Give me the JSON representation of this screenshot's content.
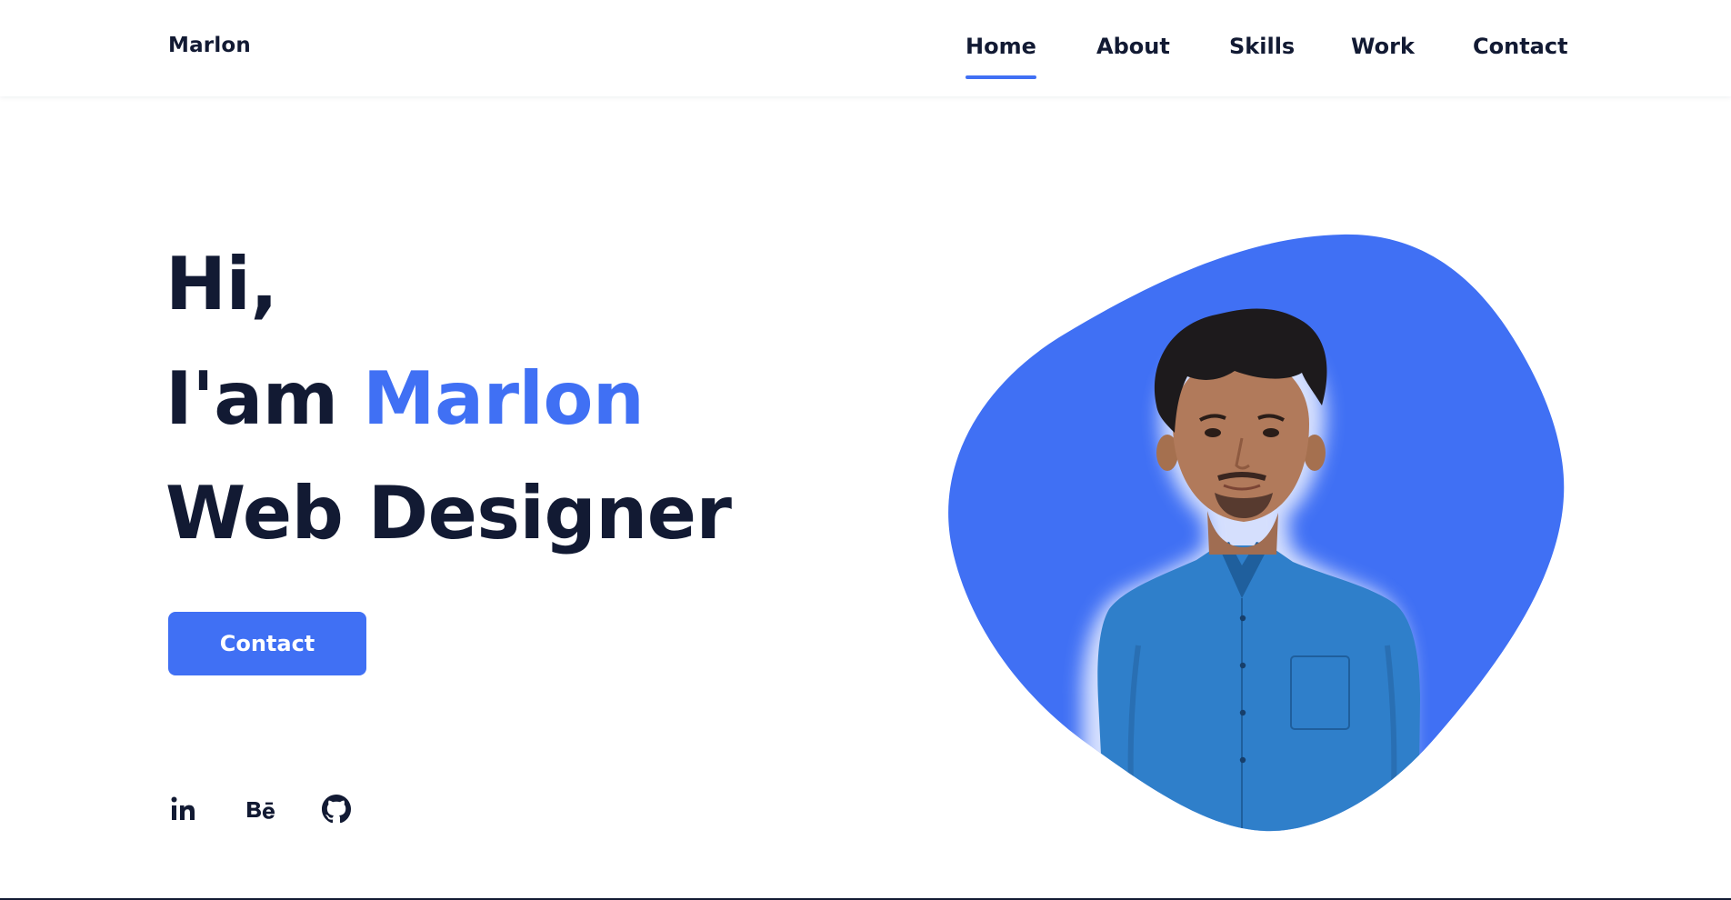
{
  "header": {
    "logo": "Marlon",
    "nav": [
      {
        "label": "Home",
        "active": true
      },
      {
        "label": "About",
        "active": false
      },
      {
        "label": "Skills",
        "active": false
      },
      {
        "label": "Work",
        "active": false
      },
      {
        "label": "Contact",
        "active": false
      }
    ]
  },
  "hero": {
    "greeting": "Hi,",
    "intro_prefix": "I'am",
    "name": "Marlon",
    "role": "Web Designer",
    "cta_label": "Contact"
  },
  "social": [
    {
      "icon": "linkedin-icon",
      "glyph": "in"
    },
    {
      "icon": "behance-icon",
      "glyph": "Bē"
    },
    {
      "icon": "github-icon",
      "glyph": ""
    }
  ],
  "colors": {
    "accent": "#4070f4",
    "text": "#121a33",
    "background": "#ffffff",
    "shirt": "#2f7fca",
    "skin": "#b17a5b",
    "hair": "#1d1a1c"
  }
}
